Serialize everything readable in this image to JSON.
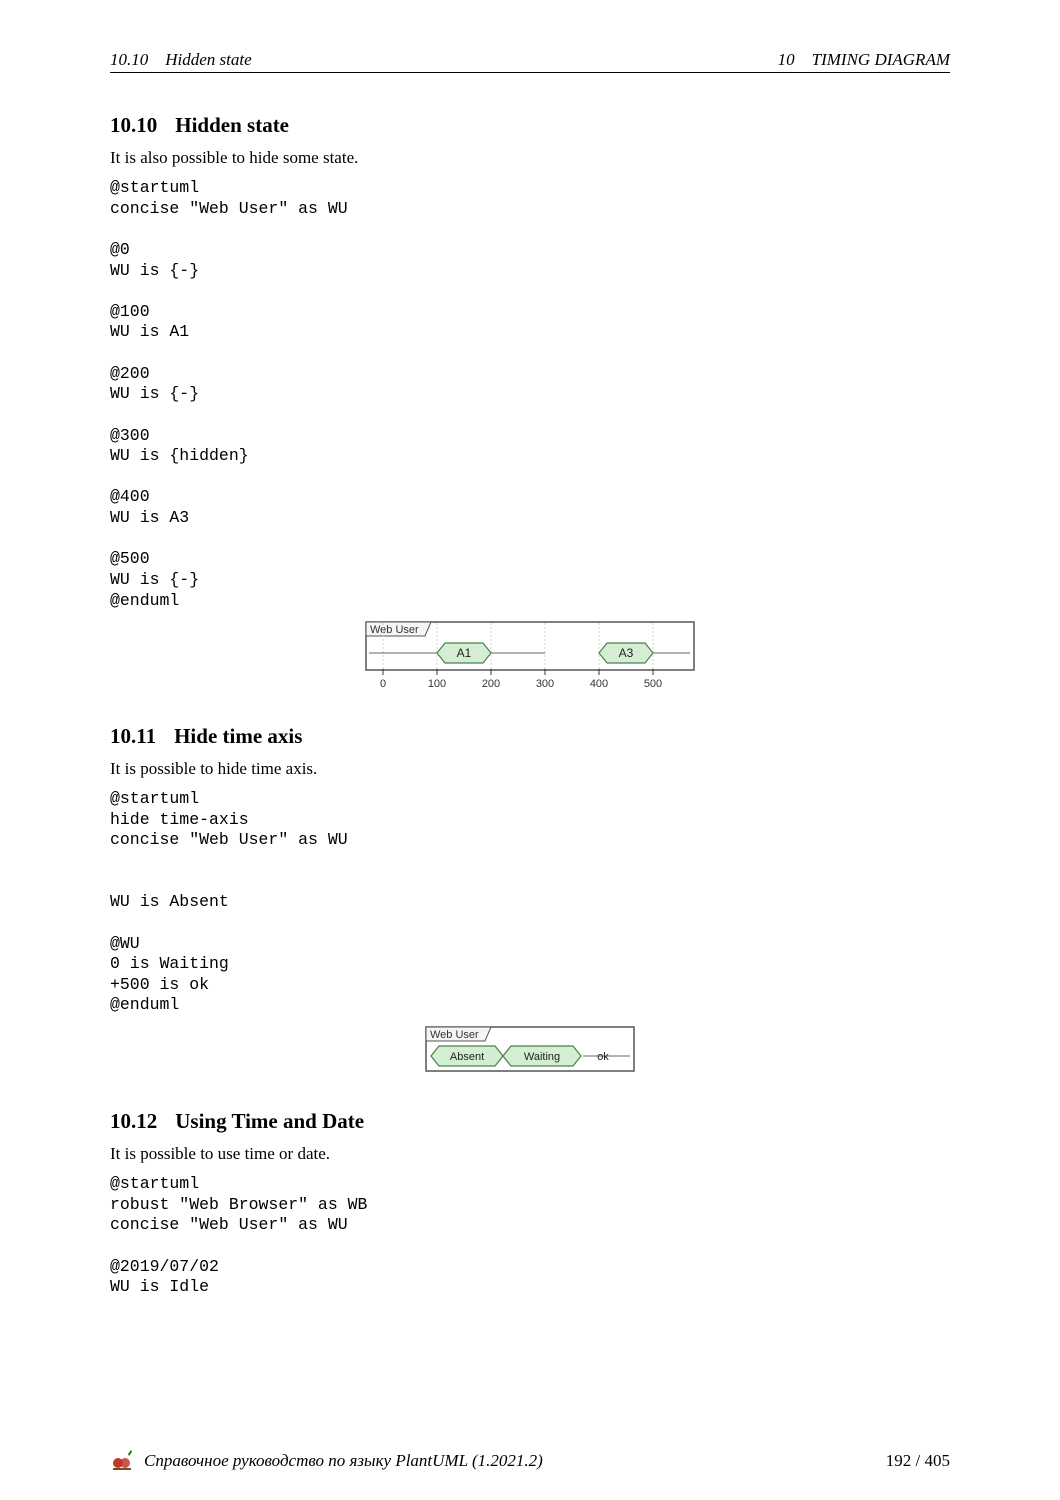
{
  "header": {
    "left_section_num": "10.10",
    "left_section_title": "Hidden state",
    "right_chapter_num": "10",
    "right_chapter_title": "TIMING DIAGRAM"
  },
  "sections": {
    "s1": {
      "num": "10.10",
      "title": "Hidden state",
      "intro": "It is also possible to hide some state.",
      "code": "@startuml\nconcise \"Web User\" as WU\n\n@0\nWU is {-}\n\n@100\nWU is A1\n\n@200\nWU is {-}\n\n@300\nWU is {hidden}\n\n@400\nWU is A3\n\n@500\nWU is {-}\n@enduml",
      "diagram": {
        "caption": "Web User",
        "states": {
          "a1": "A1",
          "a3": "A3"
        },
        "ticks": [
          "0",
          "100",
          "200",
          "300",
          "400",
          "500"
        ]
      }
    },
    "s2": {
      "num": "10.11",
      "title": "Hide time axis",
      "intro": "It is possible to hide time axis.",
      "code": "@startuml\nhide time-axis\nconcise \"Web User\" as WU\n\n\nWU is Absent\n\n@WU\n0 is Waiting\n+500 is ok\n@enduml",
      "diagram": {
        "caption": "Web User",
        "states": {
          "absent": "Absent",
          "waiting": "Waiting",
          "ok": "ok"
        }
      }
    },
    "s3": {
      "num": "10.12",
      "title": "Using Time and Date",
      "intro": "It is possible to use time or date.",
      "code": "@startuml\nrobust \"Web Browser\" as WB\nconcise \"Web User\" as WU\n\n@2019/07/02\nWU is Idle"
    }
  },
  "footer": {
    "text": "Справочное руководство по языку PlantUML (1.2021.2)",
    "page": "192 / 405"
  }
}
